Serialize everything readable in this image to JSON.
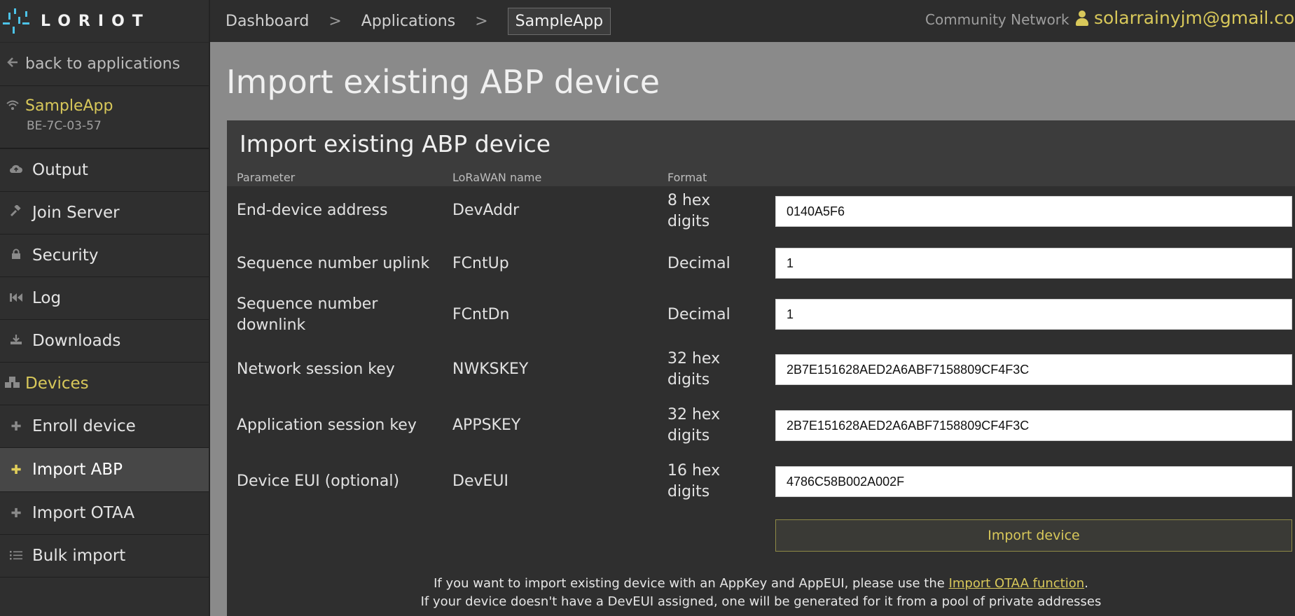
{
  "brand": {
    "logo_text": "LORIOT"
  },
  "breadcrumb": {
    "items": [
      {
        "label": "Dashboard"
      },
      {
        "label": "Applications"
      },
      {
        "label": "SampleApp"
      }
    ]
  },
  "header": {
    "network": "Community Network",
    "user_email": "solarrainyjm@gmail.co"
  },
  "sidebar": {
    "back_label": "back to applications",
    "app": {
      "name": "SampleApp",
      "id": "BE-7C-03-57"
    },
    "items": [
      {
        "label": "Output",
        "icon": "cloud-upload-icon"
      },
      {
        "label": "Join Server",
        "icon": "gavel-icon"
      },
      {
        "label": "Security",
        "icon": "lock-icon"
      },
      {
        "label": "Log",
        "icon": "backward-icon"
      },
      {
        "label": "Downloads",
        "icon": "download-icon"
      },
      {
        "label": "Devices",
        "icon": "cubes-icon"
      },
      {
        "label": "Enroll device",
        "icon": "plus-icon"
      },
      {
        "label": "Import ABP",
        "icon": "plus-icon",
        "active": true
      },
      {
        "label": "Import OTAA",
        "icon": "plus-icon"
      },
      {
        "label": "Bulk import",
        "icon": "list-icon"
      }
    ]
  },
  "main": {
    "page_title": "Import existing ABP device",
    "panel_title": "Import existing ABP device",
    "columns": [
      "Parameter",
      "LoRaWAN name",
      "Format"
    ],
    "rows": [
      {
        "param": "End-device address",
        "name": "DevAddr",
        "format": "8 hex digits",
        "value": "0140A5F6"
      },
      {
        "param": "Sequence number uplink",
        "name": "FCntUp",
        "format": "Decimal",
        "value": "1"
      },
      {
        "param": "Sequence number downlink",
        "name": "FCntDn",
        "format": "Decimal",
        "value": "1"
      },
      {
        "param": "Network session key",
        "name": "NWKSKEY",
        "format": "32 hex digits",
        "value": "2B7E151628AED2A6ABF7158809CF4F3C"
      },
      {
        "param": "Application session key",
        "name": "APPSKEY",
        "format": "32 hex digits",
        "value": "2B7E151628AED2A6ABF7158809CF4F3C"
      },
      {
        "param": "Device EUI (optional)",
        "name": "DevEUI",
        "format": "16 hex digits",
        "value": "4786C58B002A002F"
      }
    ],
    "import_button": "Import device",
    "note1_prefix": "If you want to import existing device with an AppKey and AppEUI, please use the ",
    "note1_link": "Import OTAA function",
    "note1_suffix": ".",
    "note2": "If your device doesn't have a DevEUI assigned, one will be generated for it from a pool of private addresses"
  },
  "colors": {
    "accent_yellow": "#d8c85a",
    "logo_blue": "#4cc3e8",
    "sidebar_bg": "#2f2f2f",
    "main_bg": "#8a8a8a"
  }
}
